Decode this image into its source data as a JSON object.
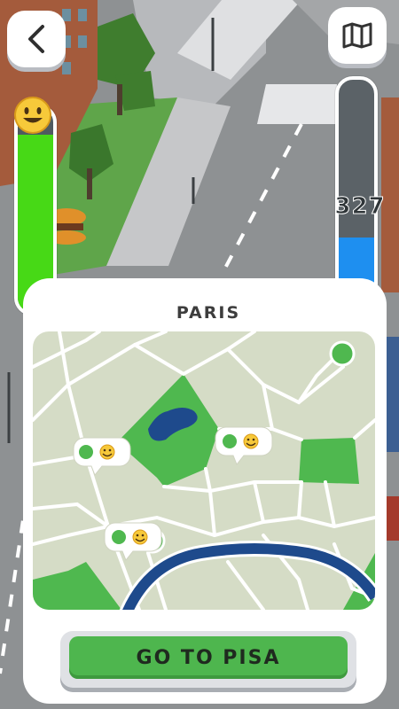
{
  "hud": {
    "back_icon": "chevron-left-icon",
    "map_icon": "folded-map-icon",
    "happiness_level": 0.87,
    "happiness_icon": "smiley-face-icon",
    "money_level": 0.32,
    "counter": "327"
  },
  "panel": {
    "city": "PARIS",
    "map_pins": [
      {
        "icon": "smiley-face-icon"
      },
      {
        "icon": "smiley-face-icon"
      },
      {
        "icon": "smiley-face-icon"
      }
    ],
    "go_button": "GO TO PISA"
  },
  "colors": {
    "happiness_fill": "#47d916",
    "money_fill": "#1e8ff0",
    "button_green": "#4eb64e",
    "map_park": "#4fb84f",
    "map_river": "#1e4a8c",
    "map_lake": "#1e4a8c",
    "map_land": "#d5dcc6"
  }
}
